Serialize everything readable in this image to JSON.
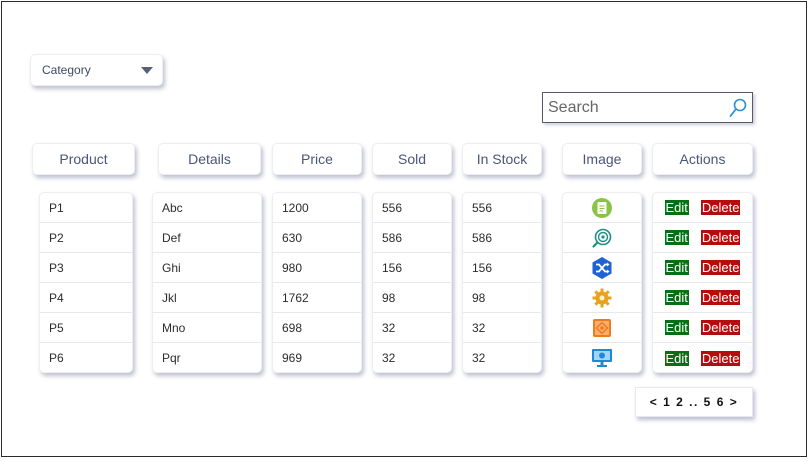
{
  "category": {
    "label": "Category"
  },
  "search": {
    "placeholder": "Search"
  },
  "headers": [
    "Product",
    "Details",
    "Price",
    "Sold",
    "In Stock",
    "Image",
    "Actions"
  ],
  "rows": [
    {
      "product": "P1",
      "details": "Abc",
      "price": "1200",
      "sold": "556",
      "in_stock": "556",
      "image_icon": "document-icon"
    },
    {
      "product": "P2",
      "details": "Def",
      "price": "630",
      "sold": "586",
      "in_stock": "586",
      "image_icon": "target-search-icon"
    },
    {
      "product": "P3",
      "details": "Ghi",
      "price": "980",
      "sold": "156",
      "in_stock": "156",
      "image_icon": "shuffle-icon"
    },
    {
      "product": "P4",
      "details": "Jkl",
      "price": "1762",
      "sold": "98",
      "in_stock": "98",
      "image_icon": "gear-icon"
    },
    {
      "product": "P5",
      "details": "Mno",
      "price": "698",
      "sold": "32",
      "in_stock": "32",
      "image_icon": "chip-icon"
    },
    {
      "product": "P6",
      "details": "Pqr",
      "price": "969",
      "sold": "32",
      "in_stock": "32",
      "image_icon": "monitor-icon"
    }
  ],
  "actions": {
    "edit": "Edit",
    "delete": "Delete"
  },
  "pagination": {
    "prev": "<",
    "p1": "1",
    "p2": "2",
    "gap": "..",
    "p5": "5",
    "p6": "6",
    "next": ">"
  },
  "colors": {
    "edit": "#0a6e14",
    "delete": "#b50d0d",
    "header_text": "#4a5578"
  }
}
